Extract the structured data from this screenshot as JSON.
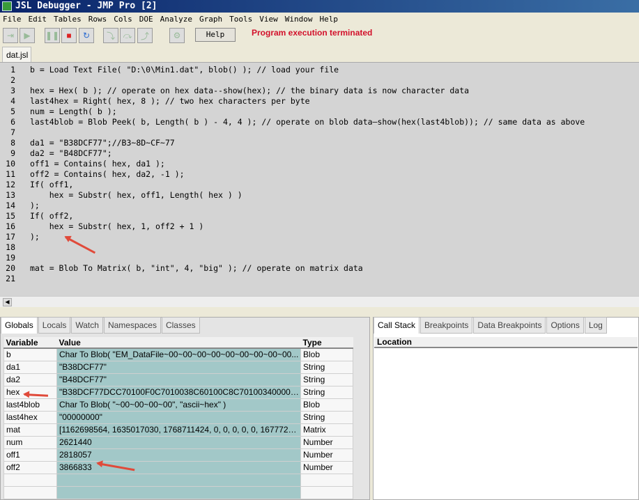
{
  "window": {
    "title": "JSL Debugger - JMP Pro [2]"
  },
  "menu": [
    "File",
    "Edit",
    "Tables",
    "Rows",
    "Cols",
    "DOE",
    "Analyze",
    "Graph",
    "Tools",
    "View",
    "Window",
    "Help"
  ],
  "toolbar": {
    "help_label": "Help",
    "status": "Program execution terminated",
    "status_color": "#d2102a",
    "buttons": [
      "run-without-breakpoints-icon",
      "run-icon",
      "pause-icon",
      "stop-icon",
      "restart-icon",
      "step-into-icon",
      "step-over-icon",
      "step-out-icon",
      "debugger-options-icon"
    ]
  },
  "editor": {
    "file_tab": "dat.jsl",
    "lines": [
      "b = Load Text File( \"D:\\0\\Min1.dat\", blob() ); // load your file",
      "",
      "hex = Hex( b ); // operate on hex data--show(hex); // the binary data is now character data",
      "last4hex = Right( hex, 8 ); // two hex characters per byte",
      "num = Length( b );",
      "last4blob = Blob Peek( b, Length( b ) - 4, 4 ); // operate on blob data—show(hex(last4blob)); // same data as above",
      "",
      "da1 = \"B38DCF77\";//B3~8D~CF~77",
      "da2 = \"B48DCF77\";",
      "off1 = Contains( hex, da1 );",
      "off2 = Contains( hex, da2, -1 );",
      "If( off1,",
      "    hex = Substr( hex, off1, Length( hex ) )",
      ");",
      "If( off2,",
      "    hex = Substr( hex, 1, off2 + 1 )",
      ");",
      "",
      "",
      "mat = Blob To Matrix( b, \"int\", 4, \"big\" ); // operate on matrix data",
      ""
    ]
  },
  "left_panel": {
    "tabs": [
      "Globals",
      "Locals",
      "Watch",
      "Namespaces",
      "Classes"
    ],
    "active": "Globals",
    "columns": [
      "Variable",
      "Value",
      "Type"
    ],
    "rows": [
      [
        "b",
        "Char To Blob( \"EM_DataFile~00~00~00~00~00~00~00~00~00...",
        "Blob"
      ],
      [
        "da1",
        "\"B38DCF77\"",
        "String"
      ],
      [
        "da2",
        "\"B48DCF77\"",
        "String"
      ],
      [
        "hex",
        "\"B38DCF77DCC70100F0C7010038C60100C8C70100340000004...",
        "String"
      ],
      [
        "last4blob",
        "Char To Blob( \"~00~00~00~00\", \"ascii~hex\" )",
        "Blob"
      ],
      [
        "last4hex",
        "\"00000000\"",
        "String"
      ],
      [
        "mat",
        "[1162698564, 1635017030, 1768711424, 0, 0, 0, 0, 0, 16777216, ...",
        "Matrix"
      ],
      [
        "num",
        "2621440",
        "Number"
      ],
      [
        "off1",
        "2818057",
        "Number"
      ],
      [
        "off2",
        "3866833",
        "Number"
      ],
      [
        "",
        "",
        ""
      ],
      [
        "",
        "",
        ""
      ]
    ]
  },
  "right_panel": {
    "tabs": [
      "Call Stack",
      "Breakpoints",
      "Data Breakpoints",
      "Options",
      "Log"
    ],
    "active": "Call Stack",
    "column": "Location"
  }
}
